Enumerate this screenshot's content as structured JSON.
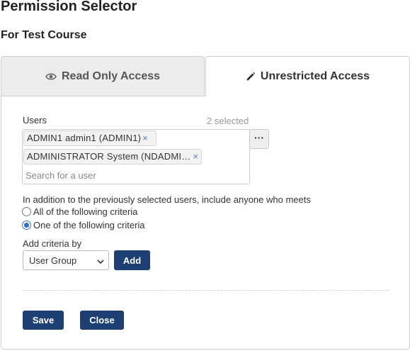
{
  "header": {
    "title": "Permission Selector",
    "subtitle": "For Test Course"
  },
  "tabs": [
    {
      "label": "Read Only Access",
      "icon": "eye-icon",
      "active": false
    },
    {
      "label": "Unrestricted Access",
      "icon": "pencil-icon",
      "active": true
    }
  ],
  "users": {
    "label": "Users",
    "selected_count": "2 selected",
    "chips": [
      {
        "label": "ADMIN1 admin1 (ADMIN1)",
        "remove": "×"
      },
      {
        "label": "ADMINISTRATOR System (NDADMINISTRATOR)",
        "remove": "×"
      }
    ],
    "search_placeholder": "Search for a user",
    "more_button_label": "···"
  },
  "criteria": {
    "intro": "In addition to the previously selected users, include anyone who meets",
    "options": [
      {
        "label": "All of the following criteria",
        "checked": false
      },
      {
        "label": "One of the following criteria",
        "checked": true
      }
    ],
    "add_by_label": "Add criteria by",
    "selected_option": "User Group",
    "add_button": "Add"
  },
  "footer": {
    "save": "Save",
    "close": "Close"
  },
  "colors": {
    "primary_button": "#1e3f74",
    "chip_remove": "#5b7fb8",
    "radio_selected": "#2b6fd6"
  }
}
